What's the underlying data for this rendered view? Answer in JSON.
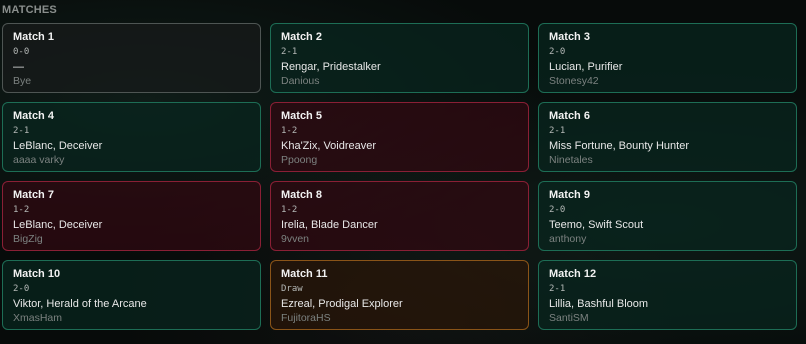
{
  "section_title": "MATCHES",
  "matches": [
    {
      "title": "Match 1",
      "score": "0-0",
      "champion": "—",
      "opponent": "Bye",
      "result": "bye"
    },
    {
      "title": "Match 2",
      "score": "2-1",
      "champion": "Rengar, Pridestalker",
      "opponent": "Danious",
      "result": "win"
    },
    {
      "title": "Match 3",
      "score": "2-0",
      "champion": "Lucian, Purifier",
      "opponent": "Stonesy42",
      "result": "win"
    },
    {
      "title": "Match 4",
      "score": "2-1",
      "champion": "LeBlanc, Deceiver",
      "opponent": "aaaa varky",
      "result": "win"
    },
    {
      "title": "Match 5",
      "score": "1-2",
      "champion": "Kha'Zix, Voidreaver",
      "opponent": "Ppoong",
      "result": "loss"
    },
    {
      "title": "Match 6",
      "score": "2-1",
      "champion": "Miss Fortune, Bounty Hunter",
      "opponent": "Ninetales",
      "result": "win"
    },
    {
      "title": "Match 7",
      "score": "1-2",
      "champion": "LeBlanc, Deceiver",
      "opponent": "BigZig",
      "result": "loss"
    },
    {
      "title": "Match 8",
      "score": "1-2",
      "champion": "Irelia, Blade Dancer",
      "opponent": "9vven",
      "result": "loss"
    },
    {
      "title": "Match 9",
      "score": "2-0",
      "champion": "Teemo, Swift Scout",
      "opponent": "anthony",
      "result": "win"
    },
    {
      "title": "Match 10",
      "score": "2-0",
      "champion": "Viktor, Herald of the Arcane",
      "opponent": "XmasHam",
      "result": "win"
    },
    {
      "title": "Match 11",
      "score": "Draw",
      "champion": "Ezreal, Prodigal Explorer",
      "opponent": "FujitoraHS",
      "result": "draw"
    },
    {
      "title": "Match 12",
      "score": "2-1",
      "champion": "Lillia, Bashful Bloom",
      "opponent": "SantiSM",
      "result": "win"
    }
  ]
}
